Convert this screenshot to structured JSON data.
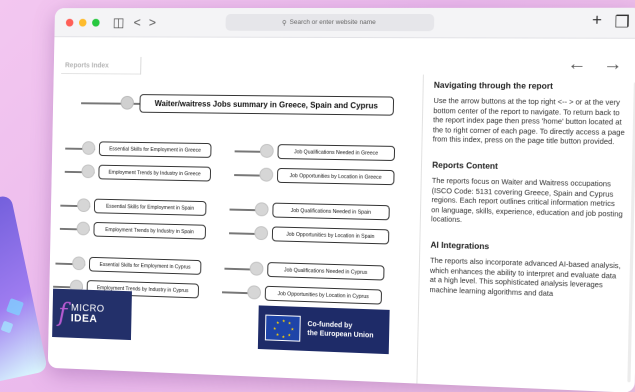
{
  "browser": {
    "address_placeholder": "Search or enter website name",
    "add_tab_label": "+",
    "back_label": "<",
    "forward_label": ">"
  },
  "page": {
    "report_index_label": "Reports Index",
    "main_title": "Waiter/waitress Jobs summary in Greece, Spain and Cyprus",
    "left_buttons": [
      "Essential Skills for Employment in Greece",
      "Employment Trends by Industry in Greece",
      "Essential Skills for Employment in Spain",
      "Employment Trends by Industry in Spain",
      "Essential Skills for Employment in Cyprus",
      "Employment Trends by Industry in Cyprus"
    ],
    "right_buttons": [
      "Job Qualifications Needed in Greece",
      "Job Opportunities by Location in Greece",
      "Job Qualifications Needed in Spain",
      "Job Opportunities by Location in Spain",
      "Job Qualifications Needed in Cyprus",
      "Job Opportunities by Location in Cyprus"
    ]
  },
  "panel": {
    "nav_heading": "Navigating through the report",
    "nav_text": "Use the arrow buttons at the top right <-- > or at the very bottom center of the report to navigate. To return back to the report index page then press 'home' button located at the to right corner of each page. To directly access a page from this index, press on the page title button provided.",
    "content_heading": "Reports Content",
    "content_text": "The reports focus on Waiter and Waitress occupations (ISCO Code: 5131 covering Greece, Spain and Cyprus regions. Each report outlines critical information metrics on language, skills, experience, education and job posting locations.",
    "ai_heading": "AI Integrations",
    "ai_text": "The reports also incorporate advanced AI-based analysis, which enhances the ability to interpret and evaluate data at a high level. This sophisticated analysis leverages machine learning algorithms and data"
  },
  "logos": {
    "micro_top": "MICRO",
    "micro_bottom": "IDEA",
    "eu_line1": "Co-funded by",
    "eu_line2": "the European Union"
  },
  "colors": {
    "dot_red": "#ff5f57",
    "dot_yellow": "#febc2e",
    "dot_green": "#28c840",
    "logo_navy": "#23306a"
  }
}
